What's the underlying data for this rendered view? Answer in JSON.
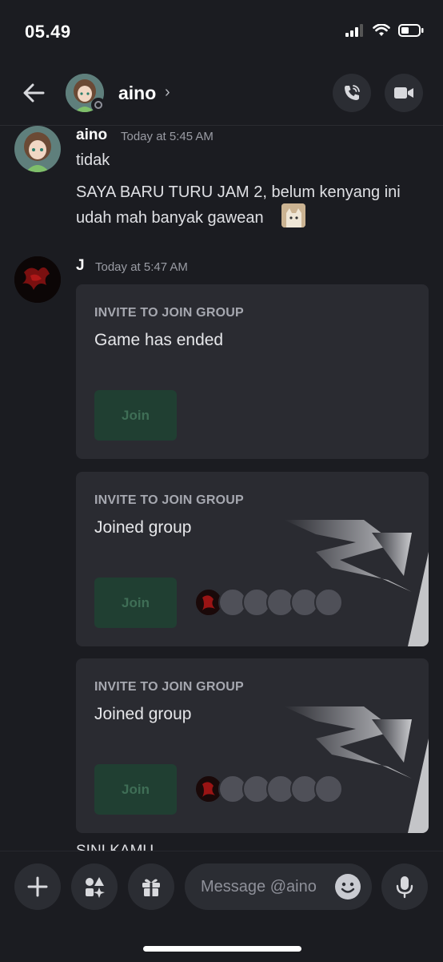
{
  "status_bar": {
    "time": "05.49"
  },
  "header": {
    "name": "aino",
    "chevron": "›"
  },
  "messages": [
    {
      "author": "aino",
      "timestamp": "Today at 5:45 AM",
      "lines": [
        "tidak",
        "SAYA BARU TURU JAM 2, belum kenyang ini",
        "udah mah banyak gawean"
      ]
    },
    {
      "author": "J",
      "timestamp": "Today at 5:47 AM"
    }
  ],
  "invites": [
    {
      "label": "INVITE TO JOIN GROUP",
      "status": "Game has ended",
      "button": "Join"
    },
    {
      "label": "INVITE TO JOIN GROUP",
      "status": "Joined group",
      "button": "Join"
    },
    {
      "label": "INVITE TO JOIN GROUP",
      "status": "Joined group",
      "button": "Join"
    }
  ],
  "cut_message": "SINI KAMU",
  "composer": {
    "placeholder": "Message @aino"
  },
  "colors": {
    "background": "#1b1c21",
    "card": "#2a2b31",
    "join_button": "#203f32",
    "join_text": "#3f6e56"
  }
}
